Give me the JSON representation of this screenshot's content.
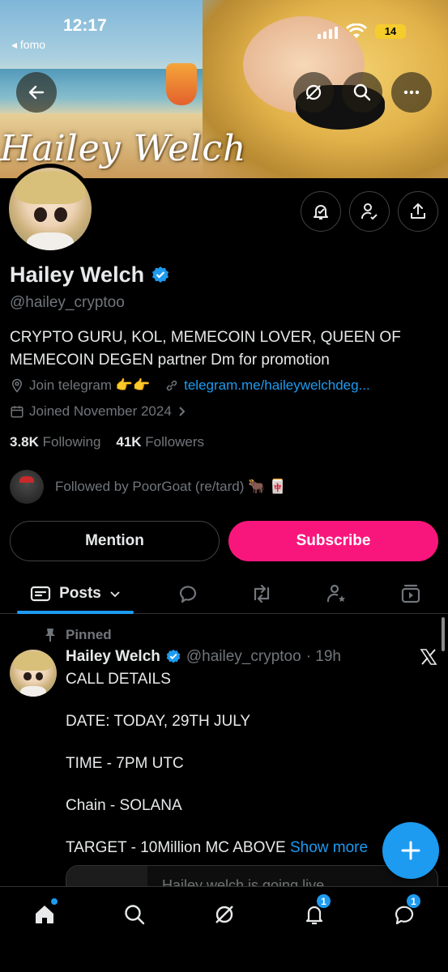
{
  "status_bar": {
    "time": "12:17",
    "back_app": "◂ fomo",
    "battery": "14"
  },
  "banner": {
    "title": "Hailey Welch"
  },
  "profile": {
    "name": "Hailey Welch",
    "handle": "@hailey_cryptoo",
    "bio": "CRYPTO GURU, KOL, MEMECOIN LOVER, QUEEN OF MEMECOIN DEGEN partner Dm for promotion",
    "location": "Join telegram 👉👉",
    "website": "telegram.me/haileywelchdeg...",
    "joined": "Joined November 2024",
    "following_count": "3.8K",
    "following_label": "Following",
    "followers_count": "41K",
    "followers_label": "Followers",
    "followed_by": "Followed by PoorGoat (re/tard) 🐂 🀄"
  },
  "buttons": {
    "mention": "Mention",
    "subscribe": "Subscribe"
  },
  "tabs": {
    "posts_label": "Posts"
  },
  "post": {
    "pinned_label": "Pinned",
    "author_name": "Hailey Welch",
    "author_handle": "@hailey_cryptoo",
    "time": "· 19h",
    "lines": [
      "CALL DETAILS",
      "DATE: TODAY, 29TH JULY",
      "TIME - 7PM  UTC",
      "Chain - SOLANA",
      "TARGET - 10Million MC ABOVE"
    ],
    "show_more": "Show more",
    "card_text": "Hailey welch is going live"
  },
  "nav": {
    "notifications_badge": "1",
    "messages_badge": "1"
  },
  "colors": {
    "accent": "#1d9bf0",
    "subscribe": "#f9167c",
    "background": "#000000",
    "muted": "#71767b"
  }
}
